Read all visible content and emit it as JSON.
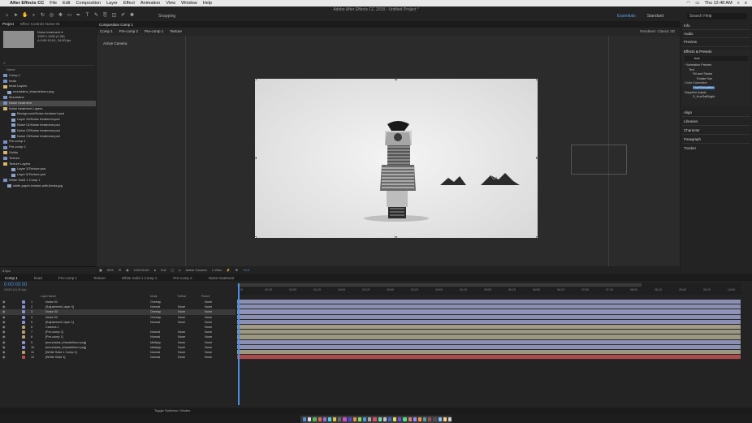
{
  "menubar": {
    "app": "After Effects CC",
    "items": [
      "File",
      "Edit",
      "Composition",
      "Layer",
      "Effect",
      "Animation",
      "View",
      "Window",
      "Help"
    ],
    "clock": "Thu 12:48 AM"
  },
  "window_title": "Adobe After Effects CC 2018 - Untitled Project *",
  "toolbar": {
    "snapping": "Snapping",
    "workspaces": [
      "Essentials",
      "Standard"
    ],
    "active_workspace": "Essentials",
    "search_placeholder": "Search Help"
  },
  "project_panel": {
    "tabs": [
      "Project",
      "Effect Controls Noise 03"
    ],
    "selected_name": "Noise treatment ▾",
    "selected_info": [
      "1920 x 1620 (1.00)",
      "Δ 0:00:10:01, 24.00 fps"
    ],
    "column_name": "Name",
    "items": [
      {
        "label": "Comp 1",
        "indent": 0,
        "type": "comp"
      },
      {
        "label": "head",
        "indent": 0,
        "type": "comp"
      },
      {
        "label": "head Layers",
        "indent": 0,
        "type": "folder"
      },
      {
        "label": "mountains_khandelhorn.png",
        "indent": 1,
        "type": "file"
      },
      {
        "label": "Mountains",
        "indent": 0,
        "type": "comp"
      },
      {
        "label": "Noise treatment",
        "indent": 0,
        "type": "comp",
        "selected": true
      },
      {
        "label": "Noise treatment Layers",
        "indent": 0,
        "type": "folder"
      },
      {
        "label": "Background/Noise treatment.psd",
        "indent": 2,
        "type": "file"
      },
      {
        "label": "Layer 24/Noise treatment.psd",
        "indent": 2,
        "type": "file"
      },
      {
        "label": "Noise 01/Noise treatment.psd",
        "indent": 2,
        "type": "file"
      },
      {
        "label": "Noise 02/Noise treatment.psd",
        "indent": 2,
        "type": "file"
      },
      {
        "label": "Noise 03/Noise treatment.psd",
        "indent": 2,
        "type": "file"
      },
      {
        "label": "Pre-comp 1",
        "indent": 0,
        "type": "comp"
      },
      {
        "label": "Pre-comp 2",
        "indent": 0,
        "type": "comp"
      },
      {
        "label": "Solids",
        "indent": 0,
        "type": "folder"
      },
      {
        "label": "Texture",
        "indent": 0,
        "type": "comp"
      },
      {
        "label": "Texture Layers",
        "indent": 0,
        "type": "folder"
      },
      {
        "label": "Layer 3/Texture.psd",
        "indent": 2,
        "type": "file"
      },
      {
        "label": "Layer 5/Texture.psd",
        "indent": 2,
        "type": "file"
      },
      {
        "label": "White Solid 1 Comp 1",
        "indent": 0,
        "type": "comp"
      },
      {
        "label": "white-paper-texture-with-flecks.jpg",
        "indent": 1,
        "type": "file"
      }
    ],
    "bpc": "8 bpc"
  },
  "composition_panel": {
    "tab": "Composition Comp 1",
    "breadcrumbs": [
      "Comp 1",
      "Pre-comp 2",
      "Pre-comp 1",
      "Texture"
    ],
    "renderer": "Renderer:  Classic 3D",
    "active_camera_label": "Active Camera",
    "controls": {
      "zoom": "50%",
      "timecode": "0:00:00:00",
      "resolution": "Full",
      "camera": "Active Camera",
      "views": "1 View",
      "exposure": "+0.0"
    }
  },
  "right_panel": {
    "sections": [
      "Info",
      "Audio",
      "Preview"
    ],
    "effects_title": "Effects & Presets",
    "effects_search": "hue",
    "effects_tree": [
      {
        "label": "* Animation Presets",
        "indent": 0
      },
      {
        "label": "Text",
        "indent": 1
      },
      {
        "label": "Fill and Stroke",
        "indent": 2
      },
      {
        "label": "Rotate Hue",
        "indent": 3
      },
      {
        "label": "Color Correction",
        "indent": 0
      },
      {
        "label": "Hue/Saturation",
        "indent": 2,
        "selected": true
      },
      {
        "label": "Sapphire Adjust",
        "indent": 0
      },
      {
        "label": "S_HueSatBright",
        "indent": 2
      }
    ],
    "lower_sections": [
      "Align",
      "Libraries",
      "Character",
      "Paragraph",
      "Tracker"
    ]
  },
  "timeline": {
    "tabs": [
      "Comp 1",
      "head",
      "Pre-comp 1",
      "Texture",
      "White Solid 1 Comp 1",
      "Pre-comp 2",
      "Noise treatment"
    ],
    "timecode": "0:00:00:00",
    "frames": "00000 (24.00 fps)",
    "headers": {
      "name": "Layer Name",
      "mode": "Mode",
      "trkmat": "TrkMat",
      "parent": "Parent"
    },
    "ruler_ticks": [
      "0f",
      "00:12f",
      "01:00f",
      "01:12f",
      "02:00f",
      "02:12f",
      "03:00f",
      "03:12f",
      "04:00f",
      "04:12f",
      "05:00f",
      "05:12f",
      "06:00f",
      "06:12f",
      "07:00f",
      "07:12f",
      "08:00f",
      "08:12f",
      "09:00f",
      "09:12f",
      "10:00f"
    ],
    "layers": [
      {
        "num": "1",
        "name": "Noise 01",
        "mode": "Overlay",
        "trk": "",
        "parent": "None",
        "color": "#8a8fd6",
        "bar": "#8b8fb3"
      },
      {
        "num": "2",
        "name": "[Adjustment Layer 4]",
        "mode": "Normal",
        "trk": "None",
        "parent": "None",
        "color": "#8a8fd6",
        "bar": "#8b8fb3"
      },
      {
        "num": "3",
        "name": "Noise 03",
        "mode": "Overlay",
        "trk": "None",
        "parent": "None",
        "color": "#8a8fd6",
        "bar": "#9094b8",
        "selected": true
      },
      {
        "num": "4",
        "name": "Noise 02",
        "mode": "Overlay",
        "trk": "None",
        "parent": "None",
        "color": "#8a8fd6",
        "bar": "#8b8fb3"
      },
      {
        "num": "5",
        "name": "[Adjustment Layer 1]",
        "mode": "Normal",
        "trk": "None",
        "parent": "None",
        "color": "#8a8fd6",
        "bar": "#8b8fb3"
      },
      {
        "num": "6",
        "name": "Camera 1",
        "mode": "",
        "trk": "",
        "parent": "None",
        "color": "#b7a06a",
        "bar": "#a09a86"
      },
      {
        "num": "7",
        "name": "[Pre-comp 2]",
        "mode": "Normal",
        "trk": "None",
        "parent": "None",
        "color": "#b7a06a",
        "bar": "#9c9783"
      },
      {
        "num": "8",
        "name": "[Pre-comp 1]",
        "mode": "Normal",
        "trk": "None",
        "parent": "None",
        "color": "#b7a06a",
        "bar": "#9c9783"
      },
      {
        "num": "9",
        "name": "[mountains_khandelhorn.png]",
        "mode": "Multiply",
        "trk": "None",
        "parent": "None",
        "color": "#8a8fd6",
        "bar": "#8b8fb3"
      },
      {
        "num": "10",
        "name": "[mountains_khandelhorn.png]",
        "mode": "Multiply",
        "trk": "None",
        "parent": "None",
        "color": "#8a8fd6",
        "bar": "#8b8fb3"
      },
      {
        "num": "11",
        "name": "[White Solid 1 Comp 1]",
        "mode": "Normal",
        "trk": "None",
        "parent": "None",
        "color": "#b7a06a",
        "bar": "#9c9783"
      },
      {
        "num": "12",
        "name": "[White Solid 1]",
        "mode": "Normal",
        "trk": "None",
        "parent": "None",
        "color": "#c24a4a",
        "bar": "#b04a4a"
      }
    ],
    "toggle_label": "Toggle Switches / Modes"
  }
}
